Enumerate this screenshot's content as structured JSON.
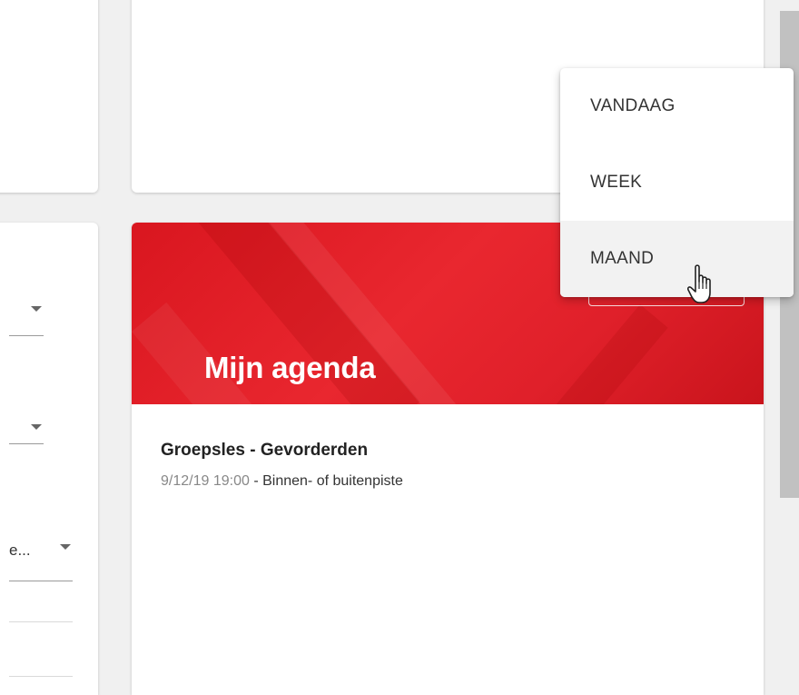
{
  "filters": {
    "field_3_value": "e..."
  },
  "agenda": {
    "title": "Mijn agenda",
    "event": {
      "title": "Groepsles - Gevorderden",
      "datetime": "9/12/19 19:00",
      "separator": " - ",
      "location": "Binnen- of buitenpiste"
    }
  },
  "period_menu": {
    "items": [
      {
        "label": "VANDAAG"
      },
      {
        "label": "WEEK"
      },
      {
        "label": "MAAND"
      }
    ],
    "hovered_item": "MAAND"
  },
  "colors": {
    "brand_red": "#e0202a",
    "menu_hover": "#f2f2f2",
    "scrollbar_thumb": "#c1c1c1"
  },
  "icons": {
    "dropdown_arrow": "caret-down-icon",
    "cursor": "hand-pointer-icon"
  }
}
